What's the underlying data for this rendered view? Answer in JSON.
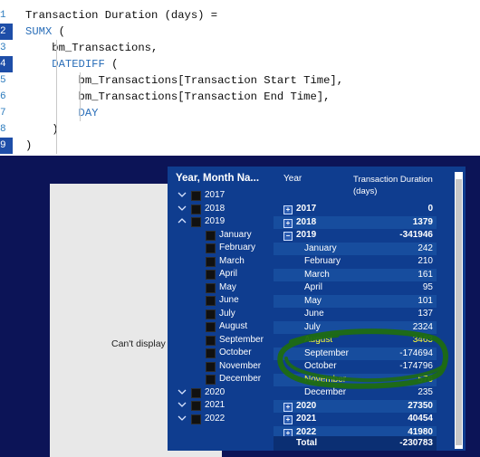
{
  "editor": {
    "line_numbers": [
      "1",
      "2",
      "3",
      "4",
      "5",
      "6",
      "7",
      "8",
      "9"
    ],
    "lines": [
      {
        "text": "Transaction Duration (days) ="
      },
      {
        "kw": "SUMX",
        "rest": " ("
      },
      {
        "text": "    bm_Transactions,"
      },
      {
        "kw": "DATEDIFF",
        "rest": " (",
        "indent": "    "
      },
      {
        "text": "        bm_Transactions[Transaction Start Time],"
      },
      {
        "text": "        bm_Transactions[Transaction End Time],"
      },
      {
        "kw": "DAY",
        "indent": "        "
      },
      {
        "text": "    )"
      },
      {
        "text": ")"
      }
    ]
  },
  "canvas": {
    "message": "Can't display"
  },
  "slicer": {
    "title": "Year, Month Na...",
    "items": [
      {
        "label": "2017",
        "level": 0,
        "state": "collapsed"
      },
      {
        "label": "2018",
        "level": 0,
        "state": "collapsed"
      },
      {
        "label": "2019",
        "level": 0,
        "state": "expanded"
      },
      {
        "label": "January",
        "level": 1
      },
      {
        "label": "February",
        "level": 1
      },
      {
        "label": "March",
        "level": 1
      },
      {
        "label": "April",
        "level": 1
      },
      {
        "label": "May",
        "level": 1
      },
      {
        "label": "June",
        "level": 1
      },
      {
        "label": "July",
        "level": 1
      },
      {
        "label": "August",
        "level": 1
      },
      {
        "label": "September",
        "level": 1
      },
      {
        "label": "October",
        "level": 1
      },
      {
        "label": "November",
        "level": 1
      },
      {
        "label": "December",
        "level": 1
      },
      {
        "label": "2020",
        "level": 0,
        "state": "collapsed"
      },
      {
        "label": "2021",
        "level": 0,
        "state": "collapsed"
      },
      {
        "label": "2022",
        "level": 0,
        "state": "collapsed"
      }
    ]
  },
  "matrix": {
    "header_year": "Year",
    "header_measure": "Transaction Duration (days)",
    "rows": [
      {
        "label": "2017",
        "value": "0",
        "level": 0,
        "expander": "+"
      },
      {
        "label": "2018",
        "value": "1379",
        "level": 0,
        "expander": "+"
      },
      {
        "label": "2019",
        "value": "-341946",
        "level": 0,
        "expander": "−"
      },
      {
        "label": "January",
        "value": "242",
        "level": 1
      },
      {
        "label": "February",
        "value": "210",
        "level": 1
      },
      {
        "label": "March",
        "value": "161",
        "level": 1
      },
      {
        "label": "April",
        "value": "95",
        "level": 1
      },
      {
        "label": "May",
        "value": "101",
        "level": 1
      },
      {
        "label": "June",
        "value": "137",
        "level": 1
      },
      {
        "label": "July",
        "value": "2324",
        "level": 1
      },
      {
        "label": "August",
        "value": "3463",
        "level": 1,
        "highlight": true
      },
      {
        "label": "September",
        "value": "-174694",
        "level": 1
      },
      {
        "label": "October",
        "value": "-174796",
        "level": 1
      },
      {
        "label": "November",
        "value": "576",
        "level": 1,
        "highlight": true
      },
      {
        "label": "December",
        "value": "235",
        "level": 1
      },
      {
        "label": "2020",
        "value": "27350",
        "level": 0,
        "expander": "+"
      },
      {
        "label": "2021",
        "value": "40454",
        "level": 0,
        "expander": "+"
      },
      {
        "label": "2022",
        "value": "41980",
        "level": 0,
        "expander": "+"
      }
    ],
    "total_label": "Total",
    "total_value": "-230783"
  },
  "colors": {
    "background": "#0c1457",
    "visual_bg": "#0f3d8f",
    "highlight_text": "#ffff33",
    "annotation_ink": "#1f6b12",
    "keyword": "#2b6fb9"
  }
}
